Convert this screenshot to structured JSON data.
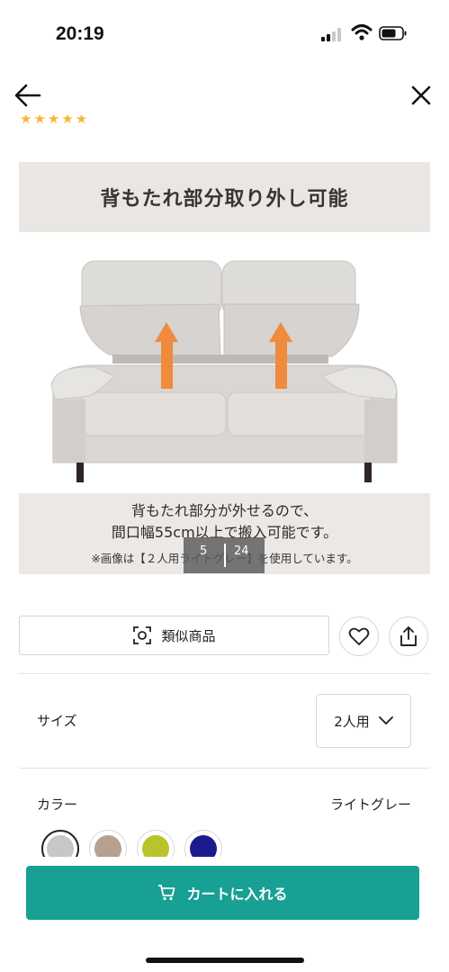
{
  "status_bar": {
    "time": "20:19",
    "icons": [
      "signal-icon",
      "wifi-icon",
      "battery-icon"
    ]
  },
  "nav": {
    "back_icon": "arrow-left-icon",
    "close_icon": "close-icon"
  },
  "rating": {
    "stars_text": "★★★★★",
    "color": "#f6b737"
  },
  "gallery": {
    "heading": "背もたれ部分取り外し可能",
    "caption_line1": "背もたれ部分が外せるので、",
    "caption_line2": "間口幅55cm以上で搬入可能です。",
    "note": "※画像は【２人用ライトグレー】を使用しています。",
    "current": "5",
    "total": "24"
  },
  "actions": {
    "similar_label": "類似商品",
    "similar_icon": "scan-icon",
    "favorite_icon": "heart-icon",
    "share_icon": "share-icon"
  },
  "size": {
    "label": "サイズ",
    "value": "2人用",
    "icon": "chevron-down-icon"
  },
  "color": {
    "label": "カラー",
    "value": "ライトグレー",
    "swatches": [
      {
        "name": "ライトグレー",
        "hex": "#c7c7c5",
        "selected": true
      },
      {
        "name": "ベージュ",
        "hex": "#b6a191",
        "selected": false
      },
      {
        "name": "イエローグリーン",
        "hex": "#b9c42c",
        "selected": false
      },
      {
        "name": "ネイビー",
        "hex": "#1b1b8f",
        "selected": false
      }
    ]
  },
  "cart": {
    "label": "カートに入れる",
    "icon": "cart-icon",
    "color": "#17a093"
  }
}
